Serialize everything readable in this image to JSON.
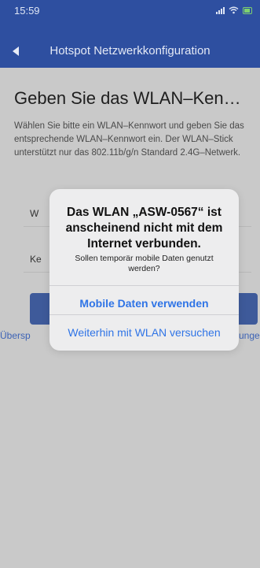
{
  "status_bar": {
    "time": "15:59",
    "icons": [
      "signal-icon",
      "wifi-icon",
      "battery-icon"
    ]
  },
  "nav": {
    "title": "Hotspot Netzwerkkonfiguration",
    "back_icon": "back-arrow-icon"
  },
  "page": {
    "heading": "Geben Sie das WLAN–Ken…",
    "description": "Wählen Sie bitte ein WLAN–Kennwort und geben Sie das entsprechende WLAN–Kennwort ein. Der WLAN–Stick unterstützt nur das 802.11b/g/n Standard 2.4G–Netwerk.",
    "field_ssid_label": "W",
    "field_password_label": "Ke",
    "skip_link": "Übersp",
    "right_link": "unge"
  },
  "alert": {
    "title": "Das WLAN „ASW-0567“ ist anscheinend nicht mit dem Internet verbunden.",
    "message": "Sollen temporär mobile Daten genutzt werden?",
    "primary_button": "Mobile Daten verwenden",
    "secondary_button": "Weiterhin mit WLAN versuchen"
  },
  "colors": {
    "header": "#2e4fa0",
    "dim_background": "#c9c9c9",
    "alert_button": "#2f74e6",
    "primary_button": "#3e5a9a"
  }
}
